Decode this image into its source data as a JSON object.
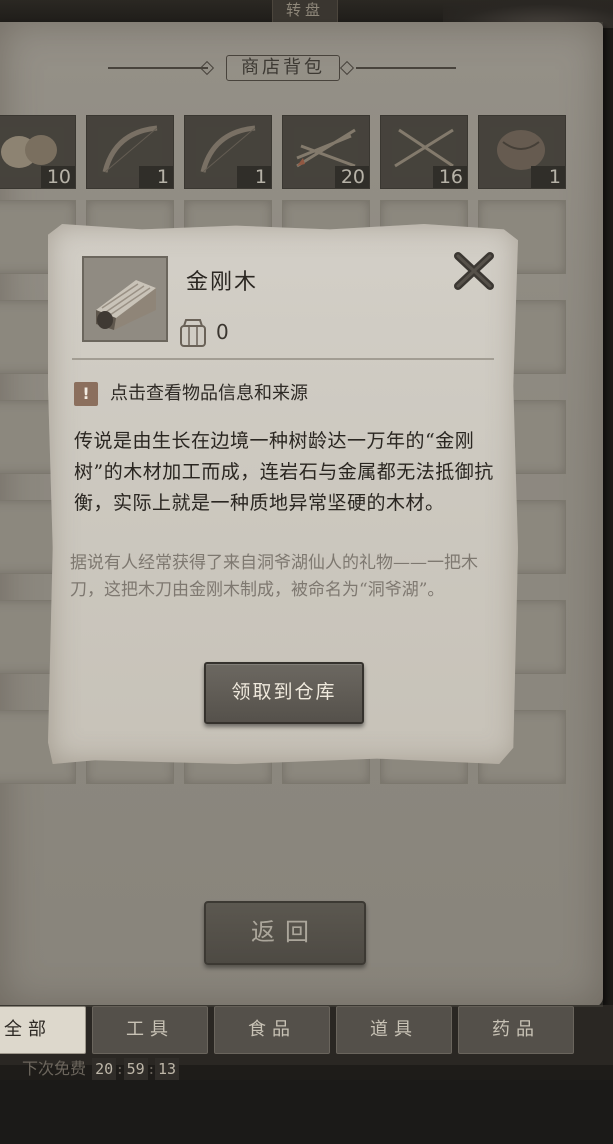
{
  "top_tab": "转盘",
  "panel": {
    "title": "商店背包",
    "slots_row1_counts": [
      "10",
      "1",
      "1",
      "20",
      "16",
      "1"
    ],
    "return_label": "返回"
  },
  "tabs": [
    {
      "label": "全部",
      "active": true
    },
    {
      "label": "工具",
      "active": false
    },
    {
      "label": "食品",
      "active": false
    },
    {
      "label": "道具",
      "active": false
    },
    {
      "label": "药品",
      "active": false
    }
  ],
  "refresh": {
    "label": "下次免费",
    "hours": "20",
    "minutes": "59",
    "seconds": "13"
  },
  "popup": {
    "item_name": "金刚木",
    "quantity": "0",
    "hint": "点击查看物品信息和来源",
    "description": "传说是由生长在边境一种树龄达一万年的“金刚树”的木材加工而成，连岩石与金属都无法抵御抗衡，实际上就是一种质地异常坚硬的木材。",
    "lore": "据说有人经常获得了来自洞爷湖仙人的礼物——一把木刀，这把木刀由金刚木制成，被命名为“洞爷湖”。",
    "claim_label": "领取到仓库"
  },
  "icons": {
    "close": "close-icon",
    "bag": "bag-icon",
    "hint": "exclamation-icon"
  },
  "colors": {
    "parchment": "#d3cfc7",
    "button_dark": "#55514b",
    "active_tab": "#ddd8cc"
  }
}
